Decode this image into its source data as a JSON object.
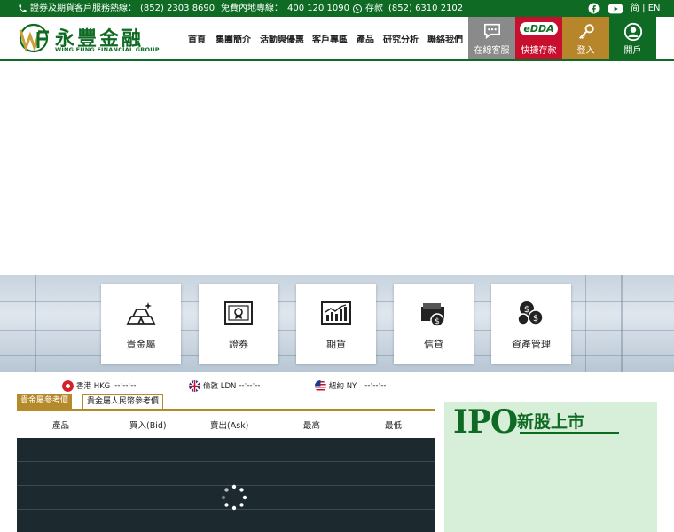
{
  "topbar": {
    "hotline": "證券及期貨客戶服務熱線：",
    "hotline_number": "(852) 2303 8690",
    "mainland": "免費內地專線：",
    "mainland_number": "400 120 1090",
    "deposit": "存款",
    "deposit_number": "(852) 6310 2102",
    "lang": "简 | EN"
  },
  "header": {
    "logo_cn": "永豐金融",
    "logo_en": "WING FUNG FINANCIAL GROUP",
    "nav": [
      "首頁",
      "集團簡介",
      "活動與優惠",
      "客戶專區",
      "產品",
      "研究分析",
      "聯絡我們"
    ],
    "tiles": {
      "chat": "在線客服",
      "edda_badge": "eDDA",
      "edda": "快捷存款",
      "login": "登入",
      "open": "開戶"
    }
  },
  "products": [
    "貴金屬",
    "證券",
    "期貨",
    "信貸",
    "資產管理"
  ],
  "prices": {
    "cities": [
      {
        "label": "香港 HKG",
        "time": "--:--:--"
      },
      {
        "label": "倫敦 LDN",
        "time": "--:--:--"
      },
      {
        "label": "紐約 NY",
        "time": "--:--:--"
      }
    ],
    "tabs": [
      "貴金屬參考價",
      "貴金屬人民幣參考價"
    ],
    "columns": [
      "產品",
      "買入(Bid)",
      "賣出(Ask)",
      "最高",
      "最低"
    ]
  },
  "ipo": {
    "title": "IPO",
    "subtitle": "新股上市"
  },
  "colors": {
    "brand_green": "#0f6b24",
    "gold": "#b58a2a",
    "table_bg": "#1c2a30"
  }
}
